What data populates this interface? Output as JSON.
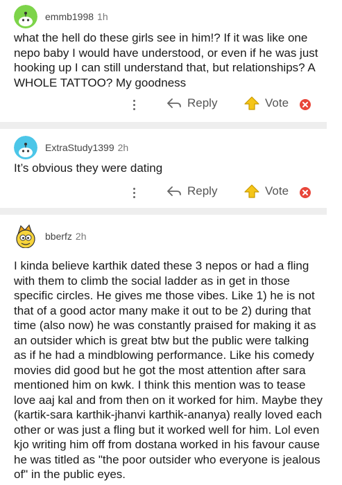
{
  "comments": [
    {
      "username": "emmb1998",
      "age": "1h",
      "body": "what the hell do these girls see in him!? If it was like one nepo baby I would have understood, or even if he was just hooking up I can still understand that, but relationships? A WHOLE TATTOO? My goodness",
      "avatar_icon": "snoo-avatar-green",
      "reply_label": "Reply",
      "vote_label": "Vote"
    },
    {
      "username": "ExtraStudy1399",
      "age": "2h",
      "body": "It’s obvious they were dating",
      "avatar_icon": "snoo-avatar-blue",
      "reply_label": "Reply",
      "vote_label": "Vote"
    },
    {
      "username": "bberfz",
      "age": "2h",
      "body": "I kinda believe karthik dated these 3 nepos or had a fling with them to climb the social ladder as in get in those specific circles. He gives me those vibes. Like 1) he is not that of a good actor many make it out to be 2) during that time (also now) he was constantly praised for making it as an outsider which is great btw but the public were talking as if he had a mindblowing performance. Like his comedy movies did good but he got the most attention after sara mentioned him on kwk. I think this mention was to tease love aaj kal and from then on it worked for him. Maybe they (kartik-sara karthik-jhanvi karthik-ananya) really loved each other or was just a fling but it worked well for him. Lol even kjo writing him off from dostana worked in his favour cause he was titled as \"the poor outsider who everyone is jealous of\" in the public eyes.",
      "avatar_icon": "yellow-cartoon-avatar"
    }
  ],
  "colors": {
    "vote_arrow": "#e8b00a",
    "downvote": "#e8463a",
    "divider": "#eeeeee"
  }
}
